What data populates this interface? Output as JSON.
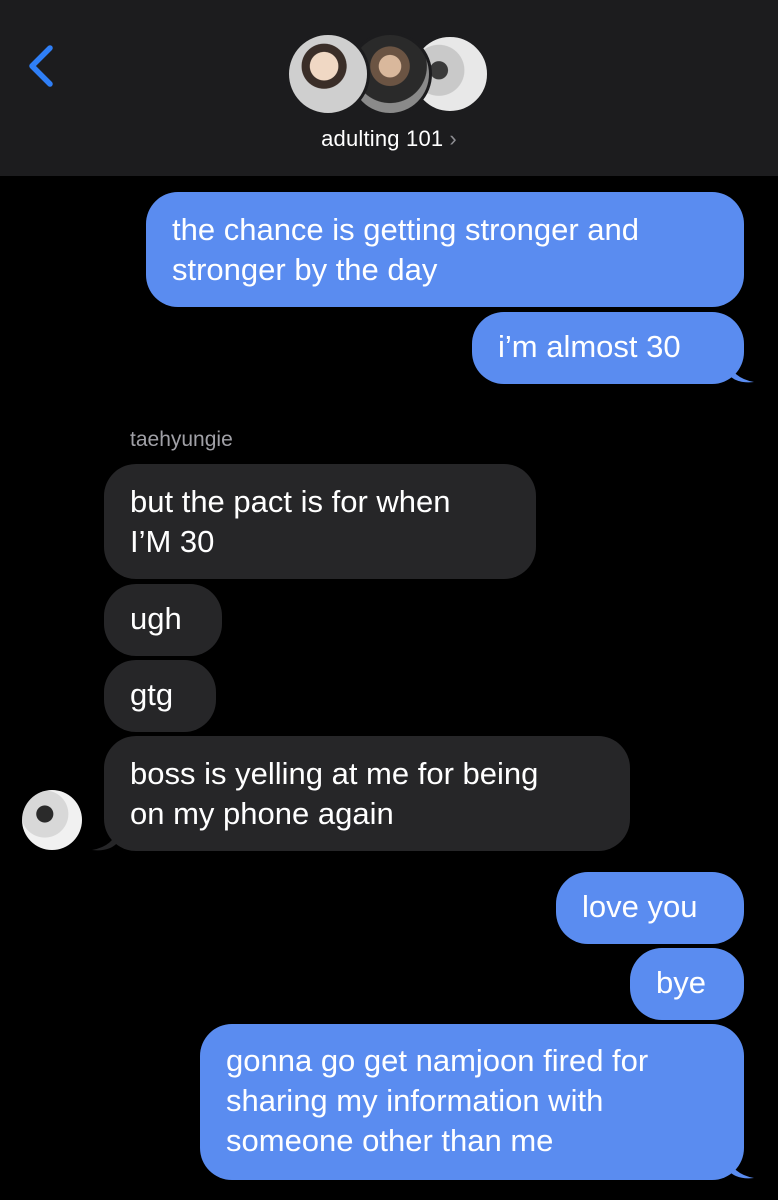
{
  "header": {
    "title": "adulting 101",
    "chevron": "›",
    "back_icon": "chevron-left-icon"
  },
  "messages": [
    {
      "side": "sent",
      "lines": [
        "the chance is getting stronger and",
        "stronger by the day"
      ]
    },
    {
      "side": "sent",
      "lines": [
        "i’m almost 30"
      ]
    },
    {
      "side": "received",
      "sender": "taehyungie",
      "lines": [
        "but the pact is for when",
        "I’M 30"
      ]
    },
    {
      "side": "received",
      "lines": [
        "ugh"
      ]
    },
    {
      "side": "received",
      "lines": [
        "gtg"
      ]
    },
    {
      "side": "received",
      "lines": [
        "boss is yelling at me for being",
        "on my phone again"
      ]
    },
    {
      "side": "sent",
      "lines": [
        "love you"
      ]
    },
    {
      "side": "sent",
      "lines": [
        "bye"
      ]
    },
    {
      "side": "sent",
      "lines": [
        "gonna go get namjoon fired for",
        "sharing my information with",
        "someone other than me"
      ]
    }
  ],
  "colors": {
    "sent_bubble": "#5a8cf0",
    "received_bubble": "#262628",
    "header_bg": "#1c1c1e",
    "accent": "#2f7ff7"
  }
}
